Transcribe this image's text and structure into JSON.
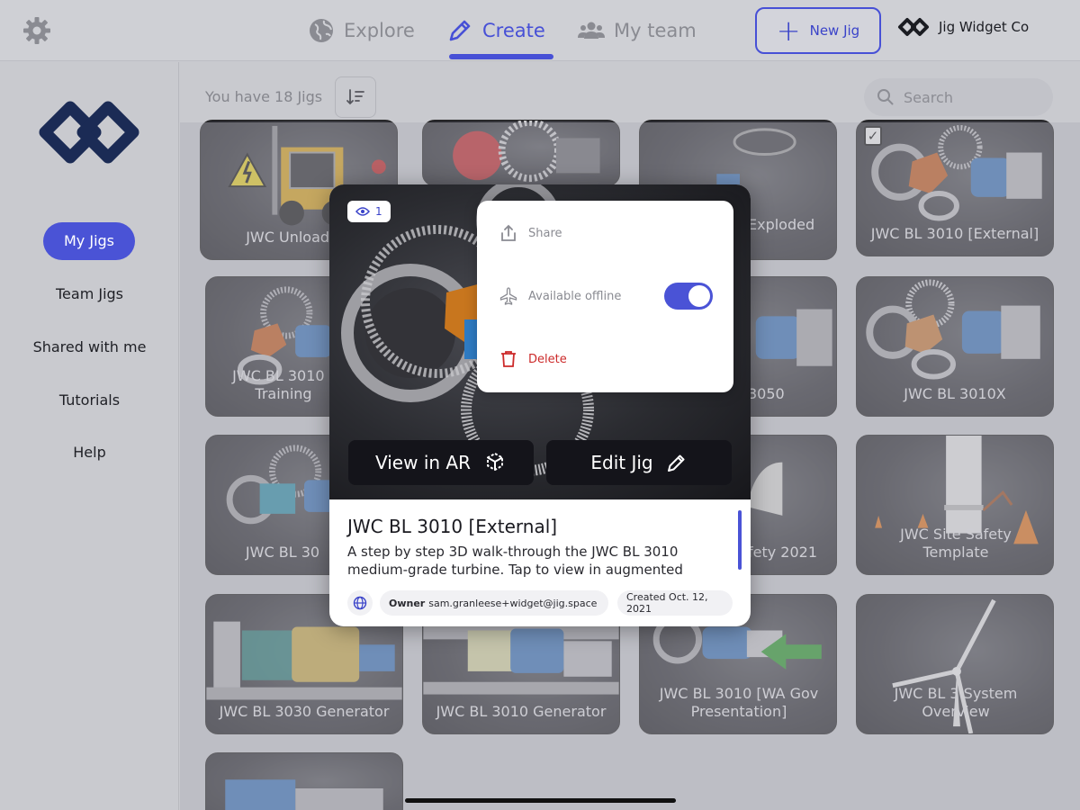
{
  "nav": {
    "settings_icon": "gear-icon",
    "tabs": [
      {
        "label": "Explore",
        "icon": "globe-icon",
        "active": false
      },
      {
        "label": "Create",
        "icon": "pencil-icon",
        "active": true
      },
      {
        "label": "My team",
        "icon": "people-icon",
        "active": false
      }
    ],
    "new_jig_label": "New Jig",
    "brand_name": "Jig Widget Co",
    "accent_color": "#4750d6"
  },
  "sidebar": {
    "items": [
      {
        "label": "My Jigs",
        "active": true
      },
      {
        "label": "Team Jigs"
      },
      {
        "label": "Shared with me"
      },
      {
        "label": "Tutorials"
      },
      {
        "label": "Help"
      }
    ]
  },
  "main": {
    "count_text": "You have 18 Jigs",
    "search_placeholder": "Search",
    "cards": [
      {
        "label": "JWC Unloading"
      },
      {
        "label": ""
      },
      {
        "label": "Exploded"
      },
      {
        "label": "JWC BL 3010 [External]",
        "checked": true
      },
      {
        "label": "JWC BL 3010 [ Training"
      },
      {
        "label": "3050"
      },
      {
        "label": "JWC BL 3010X"
      },
      {
        "label": "JWC BL 30"
      },
      {
        "label": "fety 2021"
      },
      {
        "label": "JWC Site Safety Template"
      },
      {
        "label": "JWC BL 3030 Generator"
      },
      {
        "label": "JWC BL 3010 Generator"
      },
      {
        "label": "JWC BL 3010 [WA Gov Presentation]"
      },
      {
        "label": "JWC BL 3 System Overview"
      },
      {
        "label": ""
      }
    ]
  },
  "popup": {
    "views": "1",
    "view_ar_label": "View in AR",
    "edit_label": "Edit Jig",
    "title": "JWC BL 3010 [External]",
    "description": "A step by step 3D walk-through the JWC BL 3010 medium-grade turbine. Tap to view in augmented",
    "owner_label": "Owner",
    "owner_value": "sam.granleese+widget@jig.space",
    "created": "Created Oct. 12, 2021"
  },
  "menu": {
    "share_label": "Share",
    "offline_label": "Available offline",
    "offline_enabled": true,
    "delete_label": "Delete",
    "delete_color": "#cc2a2a"
  }
}
